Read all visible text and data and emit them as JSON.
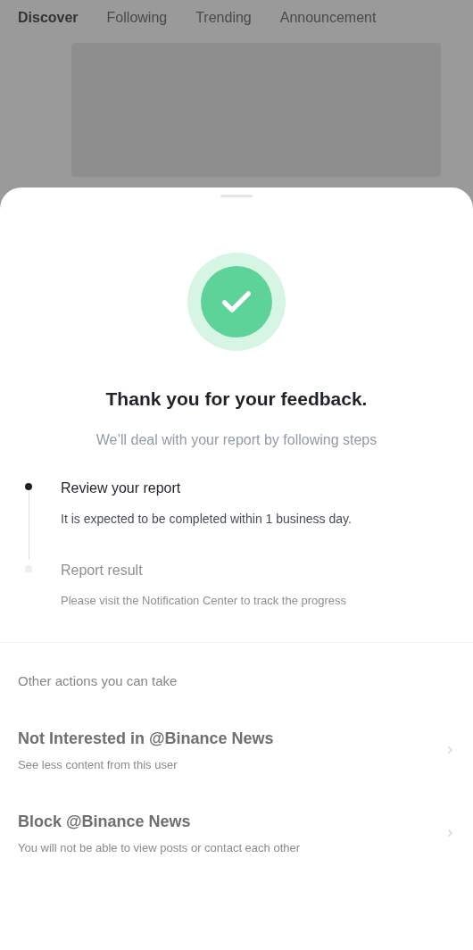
{
  "background_tabs": [
    {
      "label": "Discover",
      "selected": true
    },
    {
      "label": "Following",
      "selected": false
    },
    {
      "label": "Trending",
      "selected": false
    },
    {
      "label": "Announcement",
      "selected": false
    }
  ],
  "sheet": {
    "title": "Thank you for your feedback.",
    "subtitle": "We’ll deal with your report by following steps",
    "steps": [
      {
        "title": "Review your report",
        "description": "It is expected to be completed within 1 business day.",
        "active": true
      },
      {
        "title": "Report result",
        "description": "Please visit the Notification Center to track the progress",
        "active": false
      }
    ],
    "actions_heading": "Other actions you can take",
    "actions": [
      {
        "title": "Not Interested in @Binance News",
        "description": "See less content from this user"
      },
      {
        "title": "Block @Binance News",
        "description": "You will not be able to view posts or contact each other"
      }
    ]
  }
}
